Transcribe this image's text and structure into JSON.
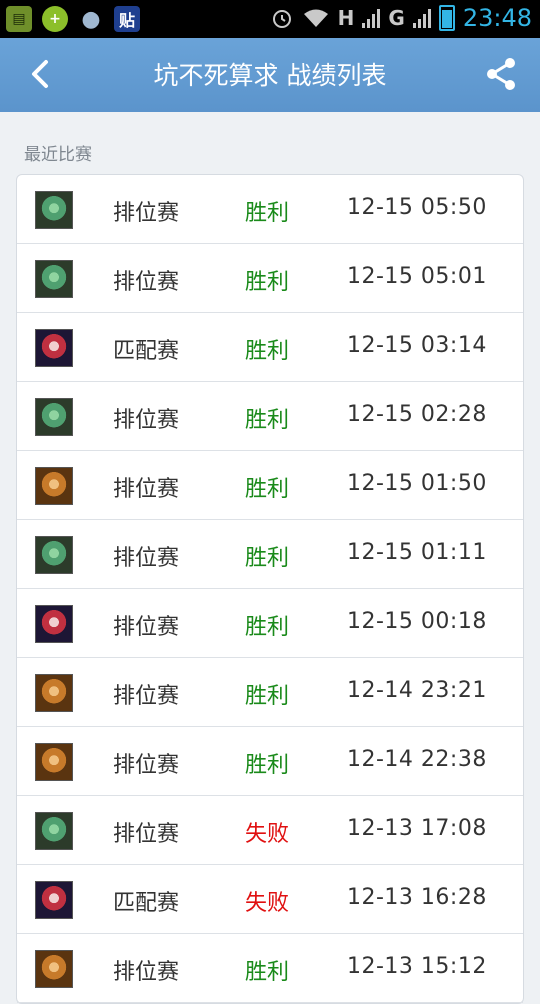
{
  "status_bar": {
    "time": "23:48",
    "icons": [
      "sd-card-icon",
      "plus-icon",
      "qq-icon",
      "tieba-icon",
      "alarm-icon",
      "wifi-icon",
      "signal-h-icon",
      "signal-g-icon",
      "battery-icon"
    ],
    "h_label": "H",
    "g_label": "G",
    "tieba_char": "贴"
  },
  "header": {
    "title": "坑不死算求 战绩列表",
    "accent": "#5b94cc"
  },
  "section": {
    "label": "最近比赛"
  },
  "colors": {
    "win": "#1a8a1a",
    "loss": "#e01010"
  },
  "matches": [
    {
      "avatar": "green-hero-icon",
      "mode": "排位赛",
      "result": "胜利",
      "win": true,
      "time": "12-15 05:50"
    },
    {
      "avatar": "green-hero-icon",
      "mode": "排位赛",
      "result": "胜利",
      "win": true,
      "time": "12-15 05:01"
    },
    {
      "avatar": "red-hero-icon",
      "mode": "匹配赛",
      "result": "胜利",
      "win": true,
      "time": "12-15 03:14"
    },
    {
      "avatar": "green-hero-icon",
      "mode": "排位赛",
      "result": "胜利",
      "win": true,
      "time": "12-15 02:28"
    },
    {
      "avatar": "bronze-hero-icon",
      "mode": "排位赛",
      "result": "胜利",
      "win": true,
      "time": "12-15 01:50"
    },
    {
      "avatar": "green-hero-icon",
      "mode": "排位赛",
      "result": "胜利",
      "win": true,
      "time": "12-15 01:11"
    },
    {
      "avatar": "red-hero-icon",
      "mode": "排位赛",
      "result": "胜利",
      "win": true,
      "time": "12-15 00:18"
    },
    {
      "avatar": "bronze-hero-icon",
      "mode": "排位赛",
      "result": "胜利",
      "win": true,
      "time": "12-14 23:21"
    },
    {
      "avatar": "bronze-hero-icon",
      "mode": "排位赛",
      "result": "胜利",
      "win": true,
      "time": "12-14 22:38"
    },
    {
      "avatar": "green-hero-icon",
      "mode": "排位赛",
      "result": "失败",
      "win": false,
      "time": "12-13 17:08"
    },
    {
      "avatar": "red-hero-icon",
      "mode": "匹配赛",
      "result": "失败",
      "win": false,
      "time": "12-13 16:28"
    },
    {
      "avatar": "bronze-hero-icon",
      "mode": "排位赛",
      "result": "胜利",
      "win": true,
      "time": "12-13 15:12"
    }
  ]
}
